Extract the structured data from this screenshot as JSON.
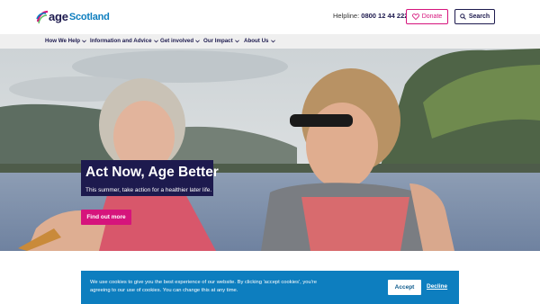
{
  "header": {
    "logo_age": "age",
    "logo_scotland": "Scotland",
    "helpline_label": "Helpline: ",
    "helpline_number": "0800 12 44 222",
    "donate_label": "Donate",
    "search_label": "Search"
  },
  "nav": {
    "items": [
      {
        "label": "How We Help"
      },
      {
        "label": "Information and Advice"
      },
      {
        "label": "Get involved"
      },
      {
        "label": "Our Impact"
      },
      {
        "label": "About Us"
      }
    ]
  },
  "hero": {
    "title": "Act Now, Age Better",
    "subtitle": "This summer, take action for a healthier later life.",
    "cta_label": "Find out more"
  },
  "cookie": {
    "text": "We use cookies to give you the best experience of our website. By clicking 'accept cookies', you're agreeing to our use of cookies. You can change this at any time.",
    "accept_label": "Accept",
    "decline_label": "Decline"
  },
  "colors": {
    "navy": "#1d1a4e",
    "pink": "#d6147c",
    "blue": "#0d7ebf",
    "nav_bg": "#efefef"
  }
}
